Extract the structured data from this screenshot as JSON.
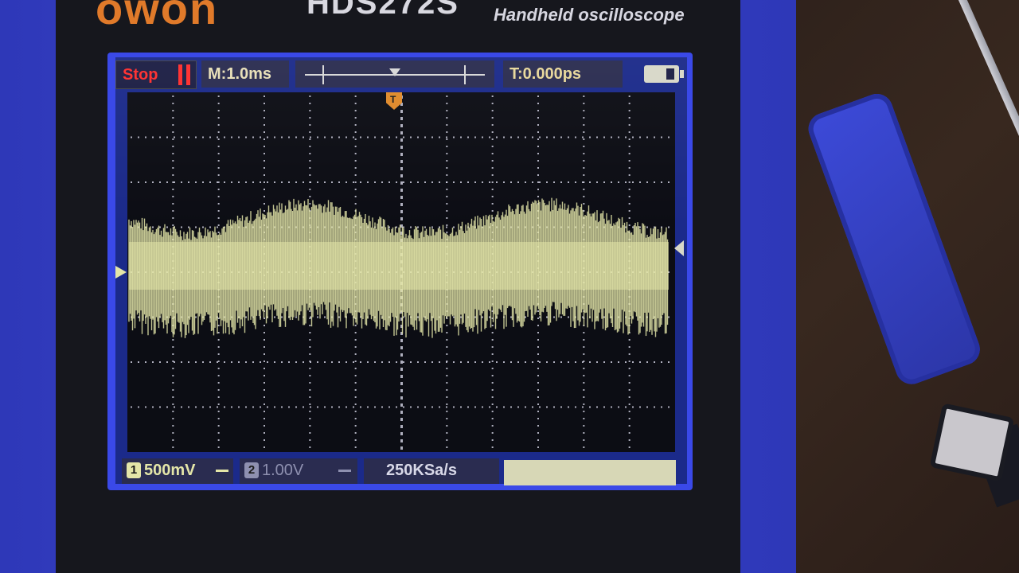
{
  "device": {
    "brand": "owon",
    "model": "HDS272S",
    "tagline": "Handheld oscilloscope"
  },
  "status": {
    "run_state": "Stop",
    "timebase": "M:1.0ms",
    "trigger_time": "T:0.000ps"
  },
  "channels": {
    "ch1": {
      "number": "1",
      "scale": "500mV"
    },
    "ch2": {
      "number": "2",
      "scale": "1.00V"
    }
  },
  "sample_rate": "250KSa/s",
  "trigger_marker": "T",
  "colors": {
    "ch1": "#e4e6a8",
    "stop": "#ff2d2d",
    "trigger": "#e08a2a",
    "screen_bg": "#0c0d14",
    "grid_dots": "#d8d8e8"
  }
}
